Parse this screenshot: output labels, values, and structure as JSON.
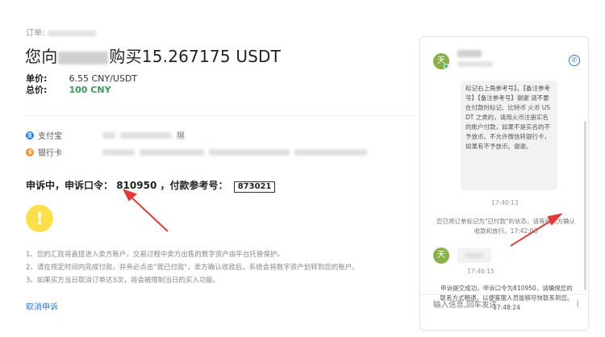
{
  "order": {
    "label": "订单:"
  },
  "title": {
    "prefix": "您向",
    "suffix": "购买15.267175 USDT"
  },
  "unit_price": {
    "label": "单价:",
    "value": "6.55 CNY/USDT"
  },
  "total": {
    "label": "总价:",
    "value": "100 CNY"
  },
  "payments": [
    {
      "icon": "alipay-icon",
      "label": "支付宝",
      "icon_char": "支"
    },
    {
      "icon": "bank-card-icon",
      "label": "银行卡",
      "icon_char": "卡"
    }
  ],
  "alipay_tail": "隰",
  "appeal": {
    "prefix": "申诉中，申诉口令：",
    "code": "810950",
    "mid": "，付款参考号：",
    "ref": "873021"
  },
  "notes": [
    "1、您的汇款将直接进入卖方账户，交易过程中卖方出售的数字资产由平台托管保护。",
    "2、请在规定时间内完成付款，并务必点击\"我已付款\"，卖方确认收款后，系统会将数字资产划转到您的账户。",
    "3、如果买方当日取消订单达3次，将会被限制当日的买入功能。"
  ],
  "cancel_label": "取消申诉",
  "chat": {
    "avatar_char": "天",
    "message1": "标记右上角参考号】。【备注参考号】【备注参考号】谢谢 请不要在付款时标记、比特币 火币 USDT 之类的，请用火币注册实名的账户付款，如果不是实名的不予放币。不允许微信转银行卡，如果有不予放币。谢谢。",
    "time1": "17:40:13",
    "system1": "您已将订单标记为\"已付款\"的状态，请等待对方确认收款和放行。17:42:03",
    "time2": "17:46:15",
    "system2": "申诉提交成功，申诉口令为810950，请确保您的联系方式畅通，以便客服人员能够尽快联系到您。17:48:24",
    "input_placeholder": "输入信息,回车发送"
  },
  "colors": {
    "accent_blue": "#2f7bd9",
    "green": "#3a9a5c",
    "warning_yellow": "#fce04a",
    "annotation_red": "#e53935"
  }
}
